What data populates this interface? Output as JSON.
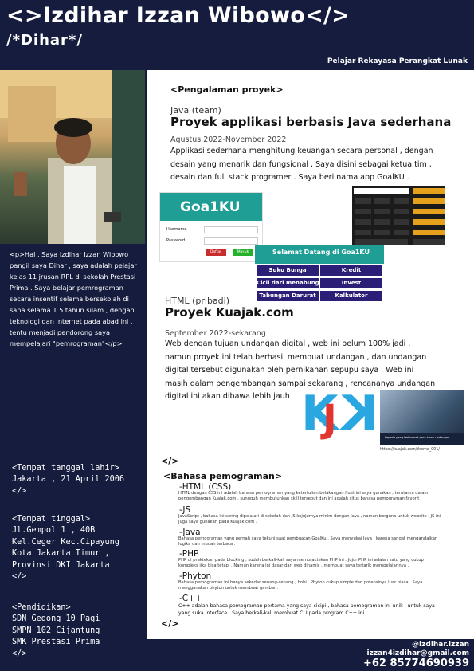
{
  "header": {
    "name": "<>Izdihar Izzan Wibowo</>",
    "nickname": "/*Dihar*/",
    "role": "Pelajar Rekayasa Perangkat Lunak"
  },
  "sidebar": {
    "about": "<p>Hai , Saya Izdihar Izzan Wibowo pangil saya Dihar , saya adalah pelajar kelas 11 jrusan RPL di sekolah Prestasi Prima . Saya belajar pemrograman secara insentif selama bersekolah di sana selama 1.5 tahun silam , dengan teknologi dan internet pada abad ini , tentu menjadi pendorong saya mempelajari \"pemrograman\"</p>",
    "birth": {
      "open": "<Tempat tanggal lahir>",
      "value": "Jakarta , 21 April 2006",
      "close": "</>"
    },
    "address": {
      "open": "<Tempat tinggal>",
      "lines": [
        "Jl.Gempol 1 , 40B",
        "Kel.Ceger Kec.Cipayung",
        "Kota Jakarta Timur ,",
        "Provinsi DKI Jakarta"
      ],
      "close": "</>"
    },
    "education": {
      "open": "<Pendidikan>",
      "lines": [
        "SDN Gedong 10 Pagi",
        "SMPN 102 Cijantung",
        "SMK Prestasi Prima"
      ],
      "close": "</>"
    }
  },
  "projects": {
    "heading": "<Pengalaman proyek>",
    "items": [
      {
        "category": "Java (team)",
        "title": "Proyek applikasi berbasis Java sederhana",
        "date": "Agustus 2022-November 2022",
        "description": "Applikasi sederhana menghitung keuangan secara personal , dengan desain yang menarik dan fungsional . Saya disini sebagai ketua tim , desain dan full stack programer . Saya beri nama app GoalKU ."
      },
      {
        "category": "HTML (pribadi)",
        "title": "Proyek Kuajak.com",
        "date": "September 2022-sekarang",
        "description": "Web dengan tujuan undangan digital , web ini belum 100% jadi , namun proyek ini telah berhasil membuat undangan , dan undangan digital tersebut digunakan oleh pernikahan sepupu saya . Web ini masih dalam pengembangan sampai sekarang , rencananya undangan digital ini akan dibawa lebih jauh"
      }
    ],
    "close": "</>"
  },
  "goalku": {
    "logo": "Goa1KU",
    "login_labels": [
      "Username",
      "Password"
    ],
    "login_buttons": [
      "Daftar",
      "Masuk"
    ],
    "welcome": "Selamat Datang di Goa1KU",
    "menu": [
      "Suku Bunga",
      "Kredit",
      "Cicil dari menabung",
      "Invest",
      "Tabungan Darurat",
      "Kalkulator"
    ]
  },
  "kuajak": {
    "logo_left": "K",
    "logo_mid": "J",
    "logo_right": "K",
    "card_caption": "kepada yang terhormat para tamu undangan",
    "url": "https://kuajak.com/theme_001/"
  },
  "languages": {
    "heading": "<Bahasa pemograman>",
    "items": [
      {
        "name": "-HTML (CSS)",
        "description": "HTML dengan CSS ini adalah bahasa pemograman yang ketertulian belakangan fluet ini saya gunakan , terutama dalam pengembangan Kuajak.com , sungguh membutuhkan skill tersebut dan ini adalah situs bahasa pemograman favorit ."
      },
      {
        "name": "-JS",
        "description": "JavaScript , bahasa ini sering dipelajari di sekolah dan JS kejujurnya minim dengan Java , namun berguna untuk website . JS ini juga saya gunakan pada Kuajak.com ."
      },
      {
        "name": "-Java",
        "description": "Bahasa pemograman yang pernah saya tekuni saat pembuatan GoalKu . Saya menyukai Java , karena sangat mengandalkan logika dan mudah terbaca ."
      },
      {
        "name": "-PHP",
        "description": "PHP di praktekan pada blocking , sudah berkali-kali saya mempraktekan PHP ini . Jujur PHP ini adalah satu yang cukup kompleks jika bisa tetapi . Namun karena ini dasar dari web dinamis , membuat saya tertarik mempelajarinya ."
      },
      {
        "name": "-Phyton",
        "description": "Bahasa pemograman ini hanya sekedar senang-senang / hobi . Phyton cukup simple dan potensinya luar biasa . Saya menggunakan phyton untuk membuat gambar ."
      },
      {
        "name": "-C++",
        "description": "C++ adalah bahasa pemograman pertama yang saya cicipi , bahasa pemograman ini unik , untuk saya yang suka interface . Saya berkali-kali membuat CLI pada program C++ ini ."
      }
    ],
    "close": "</>",
    "open_marker": "</>"
  },
  "contact": {
    "instagram": "@izdihar.izzan",
    "email": "izzan4izdihar@gmail.com",
    "phone": "+62 85774690939"
  },
  "colors": {
    "navy": "#151c3e",
    "teal": "#1f9e95",
    "purple": "#2a1e77"
  }
}
